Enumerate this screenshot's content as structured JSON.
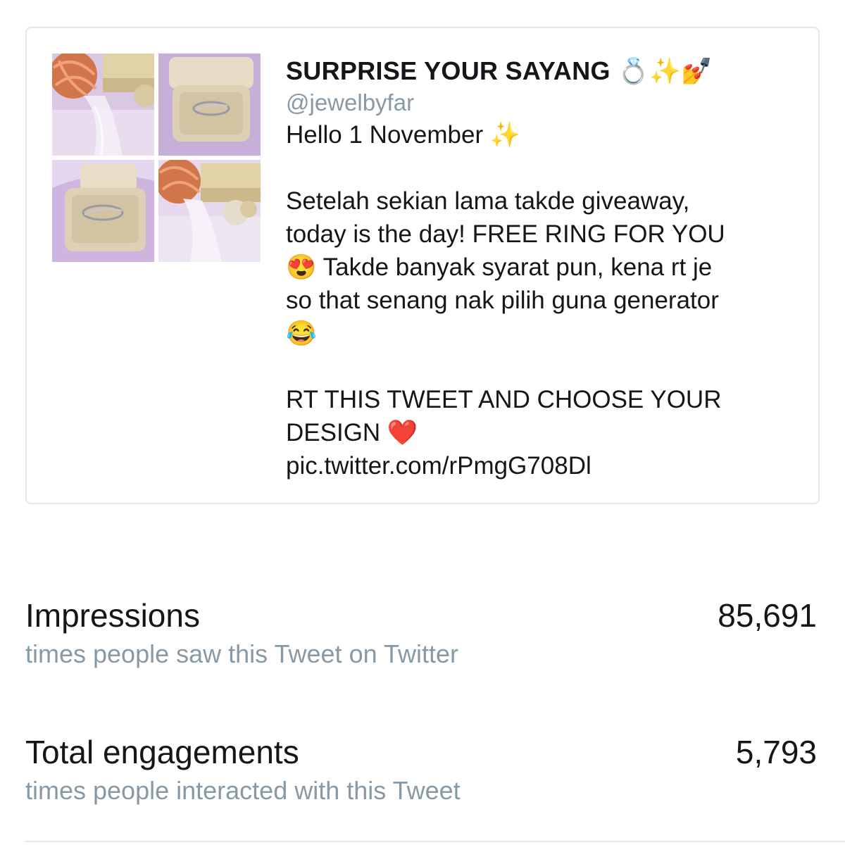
{
  "tweet": {
    "title": "SURPRISE YOUR SAYANG",
    "title_emoji": "💍✨💅",
    "handle": "@jewelbyfar",
    "lines": [
      "Hello 1 November ✨",
      "",
      "Setelah sekian lama takde giveaway,",
      "today is the day! FREE RING FOR YOU",
      "😍 Takde banyak syarat pun, kena rt je",
      "so that senang nak pilih guna generator",
      "😂",
      "",
      "RT THIS TWEET AND CHOOSE YOUR",
      "DESIGN ❤️"
    ],
    "link": "pic.twitter.com/rPmgG708Dl",
    "images": [
      "ring-photo-1",
      "ring-photo-2",
      "ring-photo-3",
      "ring-photo-4"
    ]
  },
  "metrics": [
    {
      "label": "Impressions",
      "sublabel": "times people saw this Tweet on Twitter",
      "value": "85,691"
    },
    {
      "label": "Total engagements",
      "sublabel": "times people interacted with this Tweet",
      "value": "5,793"
    }
  ],
  "colors": {
    "text": "#14171a",
    "secondary": "#8899a6",
    "border": "#e1e8ed"
  }
}
